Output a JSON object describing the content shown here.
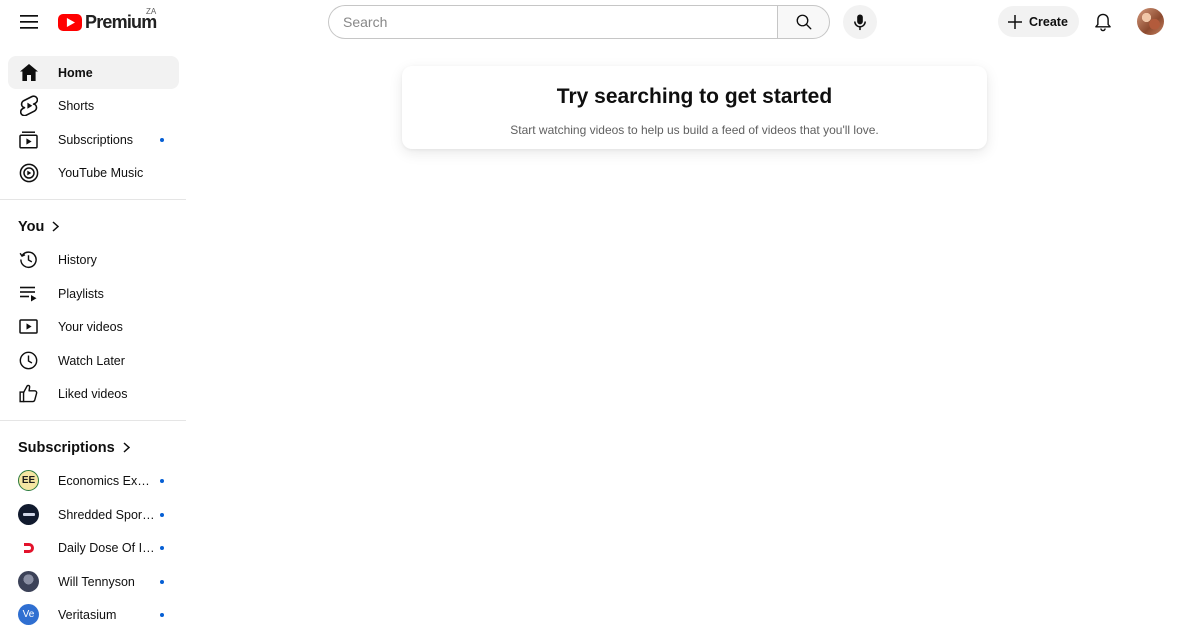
{
  "masthead": {
    "logo_text": "Premium",
    "region": "ZA",
    "search_placeholder": "Search",
    "create_label": "Create"
  },
  "sidebar": {
    "main_items": [
      {
        "label": "Home",
        "icon": "home-icon",
        "active": true
      },
      {
        "label": "Shorts",
        "icon": "shorts-icon"
      },
      {
        "label": "Subscriptions",
        "icon": "subscriptions-icon",
        "has_dot": true
      },
      {
        "label": "YouTube Music",
        "icon": "youtube-music-icon"
      }
    ],
    "you_section": {
      "title": "You",
      "items": [
        {
          "label": "History",
          "icon": "history-icon"
        },
        {
          "label": "Playlists",
          "icon": "playlists-icon"
        },
        {
          "label": "Your videos",
          "icon": "your-videos-icon"
        },
        {
          "label": "Watch Later",
          "icon": "watch-later-icon"
        },
        {
          "label": "Liked videos",
          "icon": "liked-videos-icon"
        }
      ]
    },
    "subscriptions_section": {
      "title": "Subscriptions",
      "channels": [
        {
          "label": "Economics Explained",
          "avatar_text": "EE",
          "has_dot": true
        },
        {
          "label": "Shredded Sports Science",
          "has_dot": true
        },
        {
          "label": "Daily Dose Of Internet",
          "has_dot": true
        },
        {
          "label": "Will Tennyson",
          "has_dot": true
        },
        {
          "label": "Veritasium",
          "avatar_text": "Ve",
          "has_dot": true
        }
      ]
    }
  },
  "main": {
    "card_title": "Try searching to get started",
    "card_subtitle": "Start watching videos to help us build a feed of videos that you'll love."
  },
  "colors": {
    "brand_red": "#ff0000",
    "active_bg": "#f2f2f2",
    "dot_blue": "#065fd4",
    "text_primary": "#0f0f0f",
    "text_secondary": "#606060"
  }
}
